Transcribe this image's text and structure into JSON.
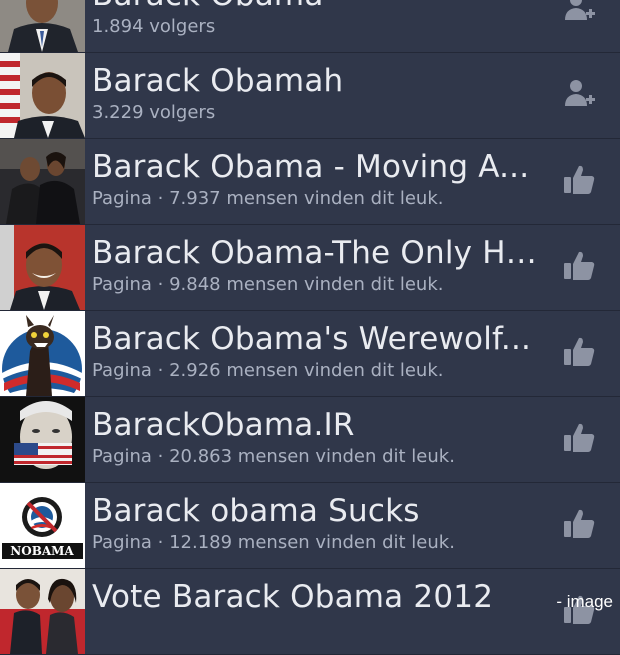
{
  "results": [
    {
      "title": "Barack Obama",
      "subtitle": "1.894 volgers",
      "action_icon": "add-friend-icon",
      "thumb": "portrait-suit"
    },
    {
      "title": "Barack Obamah",
      "subtitle": "3.229 volgers",
      "action_icon": "add-friend-icon",
      "thumb": "portrait-flag"
    },
    {
      "title": "Barack Obama - Moving A...",
      "subtitle": "Pagina · 7.937 mensen vinden dit leuk.",
      "action_icon": "like-icon",
      "thumb": "couple-dancing"
    },
    {
      "title": "Barack Obama-The Only Ho...",
      "subtitle": "Pagina · 9.848 mensen vinden dit leuk.",
      "action_icon": "like-icon",
      "thumb": "portrait-smile"
    },
    {
      "title": "Barack Obama's Werewolf...",
      "subtitle": "Pagina · 2.926 mensen vinden dit leuk.",
      "action_icon": "like-icon",
      "thumb": "werewolf-logo"
    },
    {
      "title": "BarackObama.IR",
      "subtitle": "Pagina · 20.863 mensen vinden dit leuk.",
      "action_icon": "like-icon",
      "thumb": "flag-gag"
    },
    {
      "title": "Barack obama Sucks",
      "subtitle": "Pagina · 12.189 mensen vinden dit leuk.",
      "action_icon": "like-icon",
      "thumb": "nobama-logo",
      "thumb_text": "NOBAMA"
    },
    {
      "title": "Vote Barack Obama 2012",
      "subtitle": "",
      "action_icon": "like-icon",
      "thumb": "couple-photo"
    }
  ],
  "watermark": "- image",
  "colors": {
    "background": "#30374a",
    "divider": "#232837",
    "title": "#e9ebf0",
    "subtitle": "#aab1c1",
    "icon": "#8d93a3"
  }
}
